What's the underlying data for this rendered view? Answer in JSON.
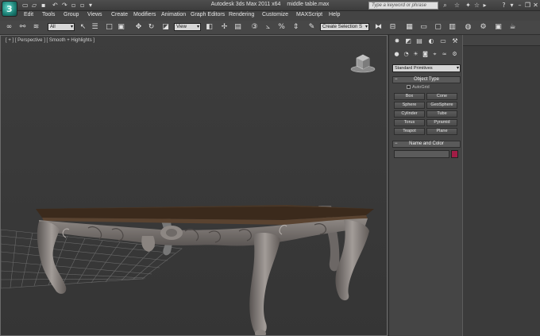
{
  "app": {
    "logo_letter": "3",
    "title": "Autodesk 3ds Max  2011 x64",
    "filename": "middle table.max"
  },
  "search": {
    "placeholder": "Type a keyword or phrase"
  },
  "menu": [
    "Edit",
    "Tools",
    "Group",
    "Views",
    "Create",
    "Modifiers",
    "Animation",
    "Graph Editors",
    "Rendering",
    "Customize",
    "MAXScript",
    "Help"
  ],
  "toolbar": {
    "selection_filter": "All",
    "reference_coord": "View",
    "named_selection": "Create Selection S"
  },
  "viewport": {
    "label": "[ + ] [ Perspective ] [ Smooth + Highlights ]"
  },
  "command_panel": {
    "category_dropdown": "Standard Primitives",
    "object_type": {
      "title": "Object Type",
      "autogrid_label": "AutoGrid",
      "buttons": [
        "Box",
        "Cone",
        "Sphere",
        "GeoSphere",
        "Cylinder",
        "Tube",
        "Torus",
        "Pyramid",
        "Teapot",
        "Plane"
      ]
    },
    "name_and_color": {
      "title": "Name and Color",
      "name_value": "",
      "color": "#a11c45"
    }
  },
  "colors": {
    "ui_bg": "#444444",
    "viewport_bg": "#3a3a3a",
    "wood_top": "#3b2a1c",
    "carving": "#8a8480"
  }
}
